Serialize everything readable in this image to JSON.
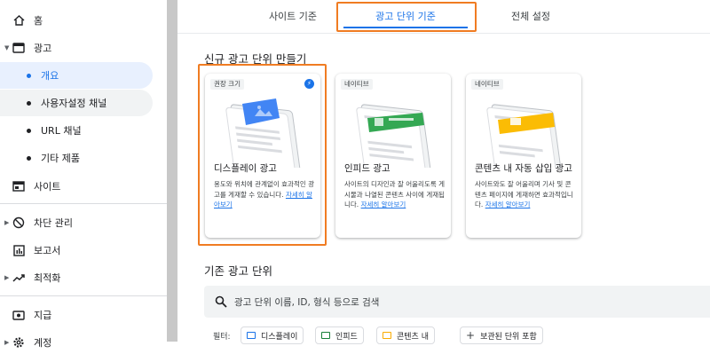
{
  "sidebar": {
    "home": "홈",
    "ads": "광고",
    "ads_sub": [
      "개요",
      "사용자설정 채널",
      "URL 채널",
      "기타 제품"
    ],
    "sites": "사이트",
    "blocking": "차단 관리",
    "reports": "보고서",
    "optimization": "최적화",
    "payments": "지급",
    "account": "계정"
  },
  "tabs": [
    "사이트 기준",
    "광고 단위 기준",
    "전체 설정"
  ],
  "new_section": {
    "title": "신규 광고 단위 만들기"
  },
  "cards": [
    {
      "tag": "권장 크기",
      "title": "디스플레이 광고",
      "desc": "용도와 위치에 관계없이 효과적인 광고를 게재할 수 있습니다.",
      "link": "자세히 알아보기",
      "accent": "#4285f4"
    },
    {
      "tag": "네이티브",
      "title": "인피드 광고",
      "desc": "사이트의 디자인과 잘 어울리도록 게시물과 나열된 콘텐츠 사이에 게재됩니다.",
      "link": "자세히 알아보기",
      "accent": "#34a853"
    },
    {
      "tag": "네이티브",
      "title": "콘텐츠 내 자동 삽입 광고",
      "desc": "사이트와도 잘 어울리며 기사 및 콘텐츠 페이지에 게재하면 효과적입니다.",
      "link": "자세히 알아보기",
      "accent": "#fbbc04"
    }
  ],
  "existing_section": {
    "title": "기존 광고 단위"
  },
  "search": {
    "placeholder": "광고 단위 이름, ID, 형식 등으로 검색"
  },
  "filters": {
    "label": "필터:",
    "chips": [
      "디스플레이",
      "인피드",
      "콘텐츠 내"
    ],
    "archived": "보관된 단위 포함"
  },
  "colors": {
    "accent": "#1a73e8",
    "highlight": "#f07c22"
  }
}
